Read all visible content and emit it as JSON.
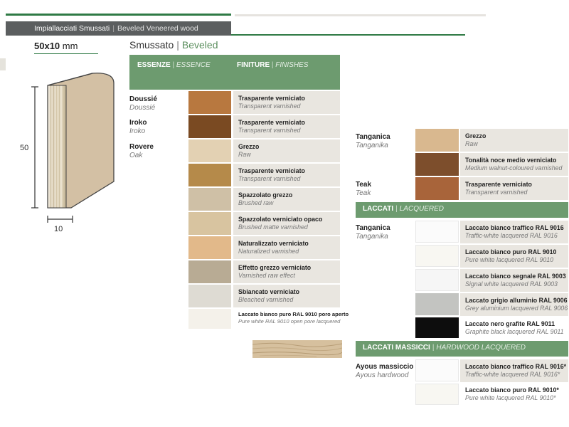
{
  "header": {
    "breadcrumb_it": "Impiallacciati Smussati",
    "breadcrumb_sep": "|",
    "breadcrumb_en": "Beveled Veneered wood"
  },
  "profile": {
    "dimension_value": "50x10",
    "dimension_unit": "mm",
    "height_label": "50",
    "width_label": "10"
  },
  "section": {
    "title_it": "Smussato",
    "title_sep": "|",
    "title_en": "Beveled"
  },
  "table_header": {
    "essence_it": "ESSENZE",
    "essence_en": "ESSENCE",
    "finish_it": "FINITURE",
    "finish_en": "FINISHES",
    "sep": "|"
  },
  "left_woods": [
    {
      "it": "Doussié",
      "en": "Doussié"
    },
    {
      "it": "Iroko",
      "en": "Iroko"
    },
    {
      "it": "Rovere",
      "en": "Oak"
    }
  ],
  "left_finishes": [
    {
      "it": "Trasparente verniciato",
      "en": "Transparent varnished",
      "color": "#b8783f"
    },
    {
      "it": "Trasparente verniciato",
      "en": "Transparent varnished",
      "color": "#7a4a22"
    },
    {
      "it": "Grezzo",
      "en": "Raw",
      "color": "#e3d1b3"
    },
    {
      "it": "Trasparente verniciato",
      "en": "Transparent varnished",
      "color": "#b58a4a"
    },
    {
      "it": "Spazzolato grezzo",
      "en": "Brushed raw",
      "color": "#cfc0a6"
    },
    {
      "it": "Spazzolato verniciato opaco",
      "en": "Brushed matte varnished",
      "color": "#d8c4a0"
    },
    {
      "it": "Naturalizzato verniciato",
      "en": "Naturalized varnished",
      "color": "#e2b98a"
    },
    {
      "it": "Effetto grezzo verniciato",
      "en": "Varnished raw effect",
      "color": "#b8ab94"
    },
    {
      "it": "Sbiancato verniciato",
      "en": "Bleached varnished",
      "color": "#dedbd3"
    },
    {
      "it": "Laccato bianco puro RAL 9010 poro aperto",
      "en": "Pure white RAL 9010 open pore lacquered",
      "color": "#f4f1ea"
    }
  ],
  "right_woods": [
    {
      "it": "Tanganica",
      "en": "Tanganika"
    },
    {
      "it": "Teak",
      "en": "Teak"
    }
  ],
  "right_finishes": [
    {
      "it": "Grezzo",
      "en": "Raw",
      "color": "#d9b88f"
    },
    {
      "it": "Tonalità noce medio verniciato",
      "en": "Medium walnut-coloured varnished",
      "color": "#7d4e2c"
    },
    {
      "it": "Trasparente verniciato",
      "en": "Transparent varnished",
      "color": "#a8643a"
    }
  ],
  "lacquered": {
    "header_it": "LACCATI",
    "header_en": "LACQUERED",
    "sep": "|",
    "wood": {
      "it": "Tanganica",
      "en": "Tanganika"
    },
    "finishes": [
      {
        "it": "Laccato bianco traffico RAL 9016",
        "en": "Traffic-white lacquered RAL 9016",
        "color": "#fbfbfb"
      },
      {
        "it": "Laccato bianco puro RAL 9010",
        "en": "Pure white lacquered RAL 9010",
        "color": "#f8f7f2"
      },
      {
        "it": "Laccato bianco segnale RAL 9003",
        "en": "Signal white lacquered RAL 9003",
        "color": "#f6f6f6"
      },
      {
        "it": "Laccato grigio alluminio RAL 9006",
        "en": "Grey aluminium lacquered RAL 9006",
        "color": "#c3c4c1"
      },
      {
        "it": "Laccato nero grafite RAL 9011",
        "en": "Graphite black lacquered RAL 9011",
        "color": "#0d0d0d"
      }
    ]
  },
  "hardwood": {
    "header_it": "LACCATI MASSICCI",
    "header_en": "HARDWOOD LACQUERED",
    "sep": "|",
    "wood": {
      "it": "Ayous massiccio",
      "en": "Ayous hardwood"
    },
    "finishes": [
      {
        "it": "Laccato bianco traffico RAL 9016*",
        "en": "Traffic-white lacquered RAL 9016*",
        "color": "#fbfbfb"
      },
      {
        "it": "Laccato bianco puro RAL 9010*",
        "en": "Pure white lacquered RAL 9010*",
        "color": "#f8f7f2"
      }
    ]
  }
}
